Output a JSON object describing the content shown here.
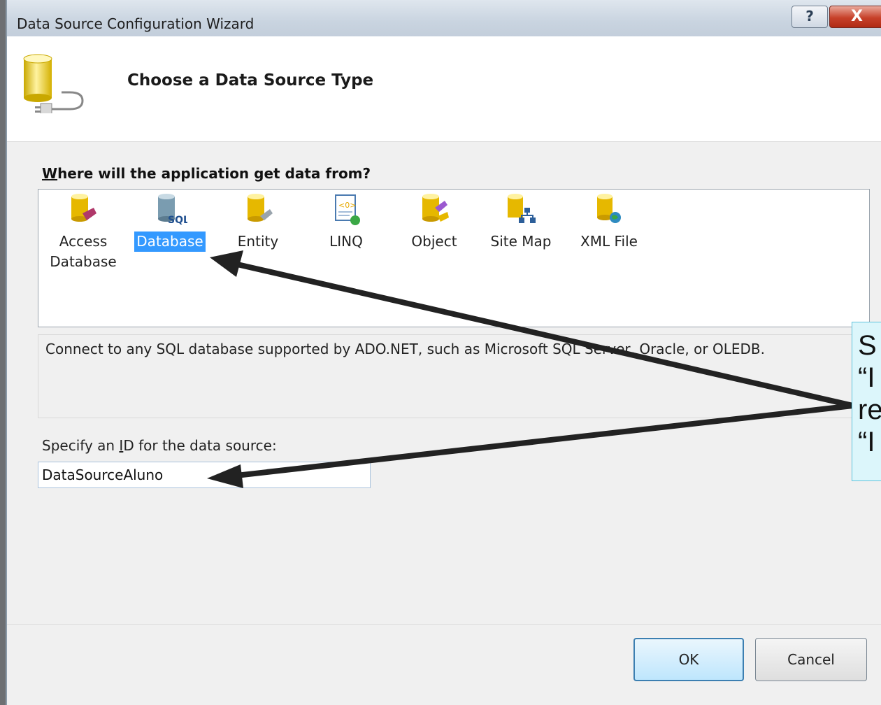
{
  "window": {
    "title": "Data Source Configuration Wizard",
    "help_label": "?",
    "close_label": "X"
  },
  "header": {
    "title": "Choose a Data Source Type"
  },
  "source_section": {
    "label_access_key": "W",
    "label_rest": "here will the application get data from?",
    "items": [
      {
        "label": "Access Database",
        "icon": "access-database-icon",
        "selected": false
      },
      {
        "label": "Database",
        "icon": "sql-database-icon",
        "selected": true
      },
      {
        "label": "Entity",
        "icon": "entity-icon",
        "selected": false
      },
      {
        "label": "LINQ",
        "icon": "linq-icon",
        "selected": false
      },
      {
        "label": "Object",
        "icon": "object-icon",
        "selected": false
      },
      {
        "label": "Site Map",
        "icon": "site-map-icon",
        "selected": false
      },
      {
        "label": "XML File",
        "icon": "xml-file-icon",
        "selected": false
      }
    ]
  },
  "description": "Connect to any SQL database supported by ADO.NET, such as Microsoft SQL Server, Oracle, or OLEDB.",
  "id_section": {
    "label_before": "Specify an ",
    "label_access_key": "I",
    "label_after": "D for the data source:",
    "value": "DataSourceAluno"
  },
  "buttons": {
    "ok": "OK",
    "cancel": "Cancel"
  },
  "callout": {
    "lines": [
      "S",
      "“I",
      "re",
      "“I"
    ]
  },
  "colors": {
    "selection": "#3399ff",
    "callout_bg": "#dcf6fb",
    "close_red": "#c7412a"
  }
}
